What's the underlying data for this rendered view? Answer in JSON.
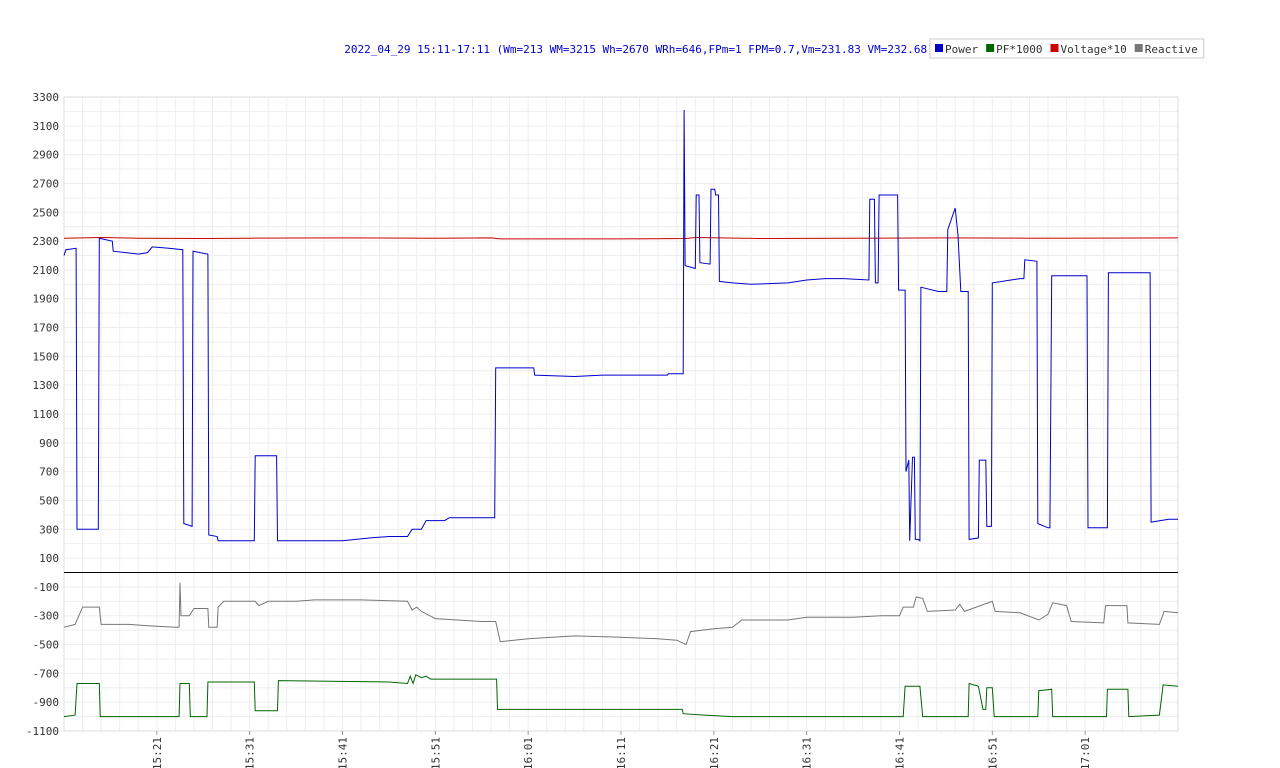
{
  "chart_data": {
    "type": "line",
    "title": "2022_04_29 15:11-17:11 (Wm=213 WM=3215 Wh=2670 WRh=646,FPm=1 FPM=0.7,Vm=231.83 VM=232.68)",
    "legend": {
      "placement": "top-right",
      "entries": [
        {
          "label": "Power",
          "color": "#0000cc"
        },
        {
          "label": "PF*1000",
          "color": "#006600"
        },
        {
          "label": "Voltage*10",
          "color": "#cc0000"
        },
        {
          "label": "Reactive",
          "color": "#777777"
        }
      ]
    },
    "xlim": [
      0,
      120
    ],
    "ylim": [
      -1100,
      3300
    ],
    "zero_line": 0,
    "grid": true,
    "y_ticks": [
      "3300",
      "3100",
      "2900",
      "2700",
      "2500",
      "2300",
      "2100",
      "1900",
      "1700",
      "1500",
      "1300",
      "1100",
      "900",
      "700",
      "500",
      "300",
      "100",
      "-100",
      "-300",
      "-500",
      "-700",
      "-900",
      "-1100"
    ],
    "y_tick_values": [
      3300,
      3100,
      2900,
      2700,
      2500,
      2300,
      2100,
      1900,
      1700,
      1500,
      1300,
      1100,
      900,
      700,
      500,
      300,
      100,
      -100,
      -300,
      -500,
      -700,
      -900,
      -1100
    ],
    "x_ticks": [
      {
        "label": "15:21",
        "t": 10
      },
      {
        "label": "15:31",
        "t": 20
      },
      {
        "label": "15:41",
        "t": 30
      },
      {
        "label": "15:51",
        "t": 40
      },
      {
        "label": "16:01",
        "t": 50
      },
      {
        "label": "16:11",
        "t": 60
      },
      {
        "label": "16:21",
        "t": 70
      },
      {
        "label": "16:31",
        "t": 80
      },
      {
        "label": "16:41",
        "t": 90
      },
      {
        "label": "16:51",
        "t": 100
      },
      {
        "label": "17:01",
        "t": 110
      }
    ],
    "series": [
      {
        "name": "Voltage*10",
        "color": "#cc0000",
        "points": [
          [
            0,
            2320
          ],
          [
            4,
            2325
          ],
          [
            8,
            2320
          ],
          [
            15,
            2318
          ],
          [
            20,
            2320
          ],
          [
            30,
            2322
          ],
          [
            40,
            2320
          ],
          [
            46,
            2322
          ],
          [
            47,
            2315
          ],
          [
            60,
            2315
          ],
          [
            67,
            2318
          ],
          [
            68,
            2325
          ],
          [
            75,
            2318
          ],
          [
            85,
            2320
          ],
          [
            95,
            2322
          ],
          [
            105,
            2320
          ],
          [
            120,
            2322
          ]
        ]
      },
      {
        "name": "Power",
        "color": "#0000cc",
        "points": [
          [
            0,
            2200
          ],
          [
            0.2,
            2240
          ],
          [
            1.3,
            2250
          ],
          [
            1.4,
            300
          ],
          [
            3.7,
            300
          ],
          [
            3.8,
            2320
          ],
          [
            5.2,
            2300
          ],
          [
            5.3,
            2230
          ],
          [
            8,
            2210
          ],
          [
            9,
            2220
          ],
          [
            9.5,
            2260
          ],
          [
            11.3,
            2250
          ],
          [
            12.8,
            2240
          ],
          [
            12.9,
            340
          ],
          [
            13.8,
            320
          ],
          [
            13.9,
            2230
          ],
          [
            15.5,
            2210
          ],
          [
            15.6,
            260
          ],
          [
            16.5,
            250
          ],
          [
            16.6,
            220
          ],
          [
            20.5,
            220
          ],
          [
            20.6,
            810
          ],
          [
            22.9,
            810
          ],
          [
            23,
            220
          ],
          [
            30,
            220
          ],
          [
            33,
            240
          ],
          [
            35,
            250
          ],
          [
            37,
            250
          ],
          [
            37.5,
            300
          ],
          [
            38.5,
            300
          ],
          [
            39,
            360
          ],
          [
            41,
            360
          ],
          [
            41.5,
            380
          ],
          [
            46.4,
            380
          ],
          [
            46.5,
            1420
          ],
          [
            50.6,
            1420
          ],
          [
            50.7,
            1370
          ],
          [
            55,
            1360
          ],
          [
            58,
            1370
          ],
          [
            65,
            1370
          ],
          [
            65.1,
            1380
          ],
          [
            66.7,
            1380
          ],
          [
            66.8,
            3210
          ],
          [
            66.9,
            2130
          ],
          [
            68,
            2110
          ],
          [
            68.1,
            2620
          ],
          [
            68.4,
            2620
          ],
          [
            68.5,
            2150
          ],
          [
            69.6,
            2140
          ],
          [
            69.7,
            2660
          ],
          [
            70.1,
            2660
          ],
          [
            70.2,
            2620
          ],
          [
            70.5,
            2620
          ],
          [
            70.6,
            2020
          ],
          [
            72,
            2010
          ],
          [
            74,
            2000
          ],
          [
            78,
            2010
          ],
          [
            80,
            2030
          ],
          [
            82,
            2040
          ],
          [
            84,
            2040
          ],
          [
            86.7,
            2030
          ],
          [
            86.8,
            2590
          ],
          [
            87.3,
            2590
          ],
          [
            87.4,
            2010
          ],
          [
            87.7,
            2010
          ],
          [
            87.8,
            2620
          ],
          [
            89.8,
            2620
          ],
          [
            89.9,
            1960
          ],
          [
            90.6,
            1960
          ],
          [
            90.7,
            700
          ],
          [
            91,
            780
          ],
          [
            91.1,
            220
          ],
          [
            91.4,
            800
          ],
          [
            91.6,
            800
          ],
          [
            91.7,
            230
          ],
          [
            92,
            230
          ],
          [
            92.2,
            220
          ],
          [
            92.3,
            1980
          ],
          [
            94.2,
            1950
          ],
          [
            94.3,
            1950
          ],
          [
            95.1,
            1950
          ],
          [
            95.2,
            2380
          ],
          [
            96,
            2530
          ],
          [
            96.3,
            2340
          ],
          [
            96.6,
            1950
          ],
          [
            97.4,
            1950
          ],
          [
            97.5,
            230
          ],
          [
            98.5,
            240
          ],
          [
            98.6,
            780
          ],
          [
            99.3,
            780
          ],
          [
            99.4,
            320
          ],
          [
            99.9,
            320
          ],
          [
            100,
            2010
          ],
          [
            102,
            2030
          ],
          [
            103,
            2040
          ],
          [
            103.4,
            2040
          ],
          [
            103.5,
            2170
          ],
          [
            104.8,
            2160
          ],
          [
            104.9,
            340
          ],
          [
            106,
            310
          ],
          [
            106.2,
            310
          ],
          [
            106.4,
            2060
          ],
          [
            110.2,
            2060
          ],
          [
            110.3,
            310
          ],
          [
            112.4,
            310
          ],
          [
            112.5,
            2080
          ],
          [
            117,
            2080
          ],
          [
            117.1,
            350
          ],
          [
            119,
            370
          ],
          [
            120,
            370
          ]
        ]
      },
      {
        "name": "Reactive",
        "color": "#777777",
        "points": [
          [
            0,
            -380
          ],
          [
            1.2,
            -360
          ],
          [
            2,
            -240
          ],
          [
            3.8,
            -240
          ],
          [
            4,
            -360
          ],
          [
            7,
            -360
          ],
          [
            9,
            -370
          ],
          [
            12,
            -380
          ],
          [
            12.4,
            -380
          ],
          [
            12.5,
            -70
          ],
          [
            12.6,
            -300
          ],
          [
            13.5,
            -300
          ],
          [
            14,
            -250
          ],
          [
            15.5,
            -250
          ],
          [
            15.6,
            -380
          ],
          [
            16.5,
            -380
          ],
          [
            16.6,
            -240
          ],
          [
            17.2,
            -200
          ],
          [
            20.6,
            -200
          ],
          [
            21,
            -230
          ],
          [
            22,
            -200
          ],
          [
            25,
            -200
          ],
          [
            27,
            -190
          ],
          [
            32,
            -190
          ],
          [
            37,
            -200
          ],
          [
            37.5,
            -260
          ],
          [
            38,
            -240
          ],
          [
            38.5,
            -270
          ],
          [
            40,
            -320
          ],
          [
            45,
            -340
          ],
          [
            46.5,
            -340
          ],
          [
            47,
            -480
          ],
          [
            50,
            -460
          ],
          [
            55,
            -440
          ],
          [
            60,
            -450
          ],
          [
            64,
            -460
          ],
          [
            66,
            -470
          ],
          [
            67,
            -500
          ],
          [
            67.5,
            -410
          ],
          [
            70,
            -390
          ],
          [
            72,
            -380
          ],
          [
            73,
            -330
          ],
          [
            78,
            -330
          ],
          [
            80,
            -310
          ],
          [
            85,
            -310
          ],
          [
            88,
            -300
          ],
          [
            90,
            -300
          ],
          [
            90.4,
            -240
          ],
          [
            91.5,
            -240
          ],
          [
            91.8,
            -170
          ],
          [
            92.5,
            -180
          ],
          [
            93,
            -270
          ],
          [
            96,
            -260
          ],
          [
            96.5,
            -220
          ],
          [
            97,
            -270
          ],
          [
            100,
            -200
          ],
          [
            100.3,
            -270
          ],
          [
            103,
            -280
          ],
          [
            105,
            -330
          ],
          [
            106,
            -290
          ],
          [
            106.5,
            -210
          ],
          [
            108,
            -230
          ],
          [
            108.5,
            -340
          ],
          [
            112,
            -350
          ],
          [
            112.2,
            -230
          ],
          [
            114.5,
            -230
          ],
          [
            114.6,
            -350
          ],
          [
            118,
            -360
          ],
          [
            118.5,
            -270
          ],
          [
            120,
            -280
          ]
        ]
      },
      {
        "name": "PF*1000",
        "color": "#006600",
        "points": [
          [
            0,
            -1000
          ],
          [
            1.2,
            -990
          ],
          [
            1.4,
            -770
          ],
          [
            3.8,
            -770
          ],
          [
            3.9,
            -1000
          ],
          [
            12.4,
            -1000
          ],
          [
            12.5,
            -770
          ],
          [
            13.5,
            -770
          ],
          [
            13.6,
            -1000
          ],
          [
            15.4,
            -1000
          ],
          [
            15.5,
            -760
          ],
          [
            20.5,
            -760
          ],
          [
            20.6,
            -960
          ],
          [
            23,
            -960
          ],
          [
            23.1,
            -750
          ],
          [
            35,
            -760
          ],
          [
            37,
            -770
          ],
          [
            37.3,
            -720
          ],
          [
            37.6,
            -770
          ],
          [
            37.9,
            -710
          ],
          [
            38.5,
            -730
          ],
          [
            39,
            -720
          ],
          [
            39.5,
            -740
          ],
          [
            46.6,
            -740
          ],
          [
            46.7,
            -950
          ],
          [
            66.6,
            -950
          ],
          [
            66.7,
            -980
          ],
          [
            69,
            -990
          ],
          [
            72,
            -1000
          ],
          [
            90.4,
            -1000
          ],
          [
            90.6,
            -790
          ],
          [
            92.2,
            -790
          ],
          [
            92.5,
            -1000
          ],
          [
            97.4,
            -1000
          ],
          [
            97.5,
            -770
          ],
          [
            98.5,
            -790
          ],
          [
            99,
            -950
          ],
          [
            99.3,
            -950
          ],
          [
            99.4,
            -800
          ],
          [
            100,
            -800
          ],
          [
            100.2,
            -1000
          ],
          [
            104.9,
            -1000
          ],
          [
            105,
            -820
          ],
          [
            106.4,
            -810
          ],
          [
            106.5,
            -1000
          ],
          [
            112.3,
            -1000
          ],
          [
            112.4,
            -810
          ],
          [
            114.6,
            -810
          ],
          [
            114.7,
            -1000
          ],
          [
            118,
            -990
          ],
          [
            118.4,
            -780
          ],
          [
            120,
            -790
          ]
        ]
      }
    ]
  }
}
